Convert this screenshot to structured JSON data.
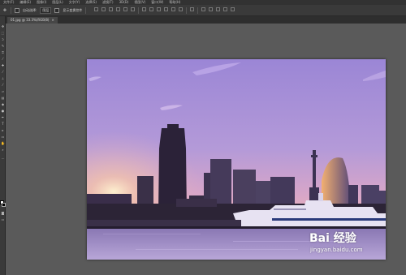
{
  "menu": {
    "items": [
      "文件(F)",
      "编辑(E)",
      "图像(I)",
      "图层(L)",
      "文字(Y)",
      "选择(S)",
      "滤镜(T)",
      "3D(D)",
      "视图(V)",
      "窗口(W)",
      "帮助(H)"
    ]
  },
  "options": {
    "auto_select_label": "自动选择:",
    "layer_value": "图层",
    "show_transform_label": "显示变换控件"
  },
  "tab": {
    "label": "01.jpg @ 33.3%(RGB/8)",
    "close_glyph": "×"
  },
  "image": {
    "description_icons": [
      "move-icon"
    ],
    "watermark_logo": "Bai 经验",
    "watermark_url": "jingyan.baidu.com"
  },
  "colors": {
    "foreground": "#ffffff",
    "background": "#000000",
    "panel": "#3a3a3a",
    "workspace": "#5a5a5a"
  }
}
